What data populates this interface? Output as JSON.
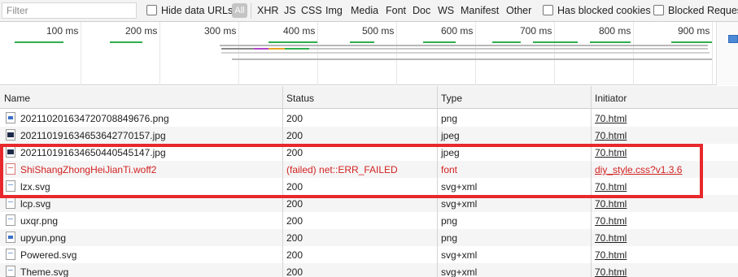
{
  "filterbar": {
    "filter_placeholder": "Filter",
    "hide_data_urls": "Hide data URLs",
    "types": [
      "All",
      "XHR",
      "JS",
      "CSS",
      "Img",
      "Media",
      "Font",
      "Doc",
      "WS",
      "Manifest",
      "Other"
    ],
    "has_blocked_cookies": "Has blocked cookies",
    "blocked_requests": "Blocked Requests"
  },
  "overview": {
    "ticks": [
      "100 ms",
      "200 ms",
      "300 ms",
      "400 ms",
      "500 ms",
      "600 ms",
      "700 ms",
      "800 ms",
      "900 ms"
    ]
  },
  "table": {
    "headers": {
      "name": "Name",
      "status": "Status",
      "type": "Type",
      "initiator": "Initiator"
    },
    "rows": [
      {
        "name": "20211020163472070884967​6.png",
        "status": "200",
        "type": "png",
        "initiator": "70.html",
        "icon": "image-file-icon"
      },
      {
        "name": "20211019163465364277015​7.jpg",
        "status": "200",
        "type": "jpeg",
        "initiator": "70.html",
        "icon": "image-file-icon"
      },
      {
        "name": "20211019163465044054514​7.jpg",
        "status": "200",
        "type": "jpeg",
        "initiator": "70.html",
        "icon": "image-file-icon"
      },
      {
        "name": "ShiShangZhongHeiJianTi.woff2",
        "status": "(failed) net::ERR_FAILED",
        "type": "font",
        "initiator": "diy_style.css?v1.3.6",
        "icon": "font-file-icon"
      },
      {
        "name": "lzx.svg",
        "status": "200",
        "type": "svg+xml",
        "initiator": "70.html",
        "icon": "svg-file-icon"
      },
      {
        "name": "lcp.svg",
        "status": "200",
        "type": "svg+xml",
        "initiator": "70.html",
        "icon": "svg-file-icon"
      },
      {
        "name": "uxqr.png",
        "status": "200",
        "type": "png",
        "initiator": "70.html",
        "icon": "image-file-icon"
      },
      {
        "name": "upyun.png",
        "status": "200",
        "type": "png",
        "initiator": "70.html",
        "icon": "image-file-icon"
      },
      {
        "name": "Powered.svg",
        "status": "200",
        "type": "svg+xml",
        "initiator": "70.html",
        "icon": "svg-file-icon"
      },
      {
        "name": "Theme.svg",
        "status": "200",
        "type": "svg+xml",
        "initiator": "70.html",
        "icon": "svg-file-icon"
      }
    ]
  },
  "colors": {
    "failed": "#d32222",
    "highlight": "#e8282c",
    "selected_type": "#c4c4c4"
  }
}
